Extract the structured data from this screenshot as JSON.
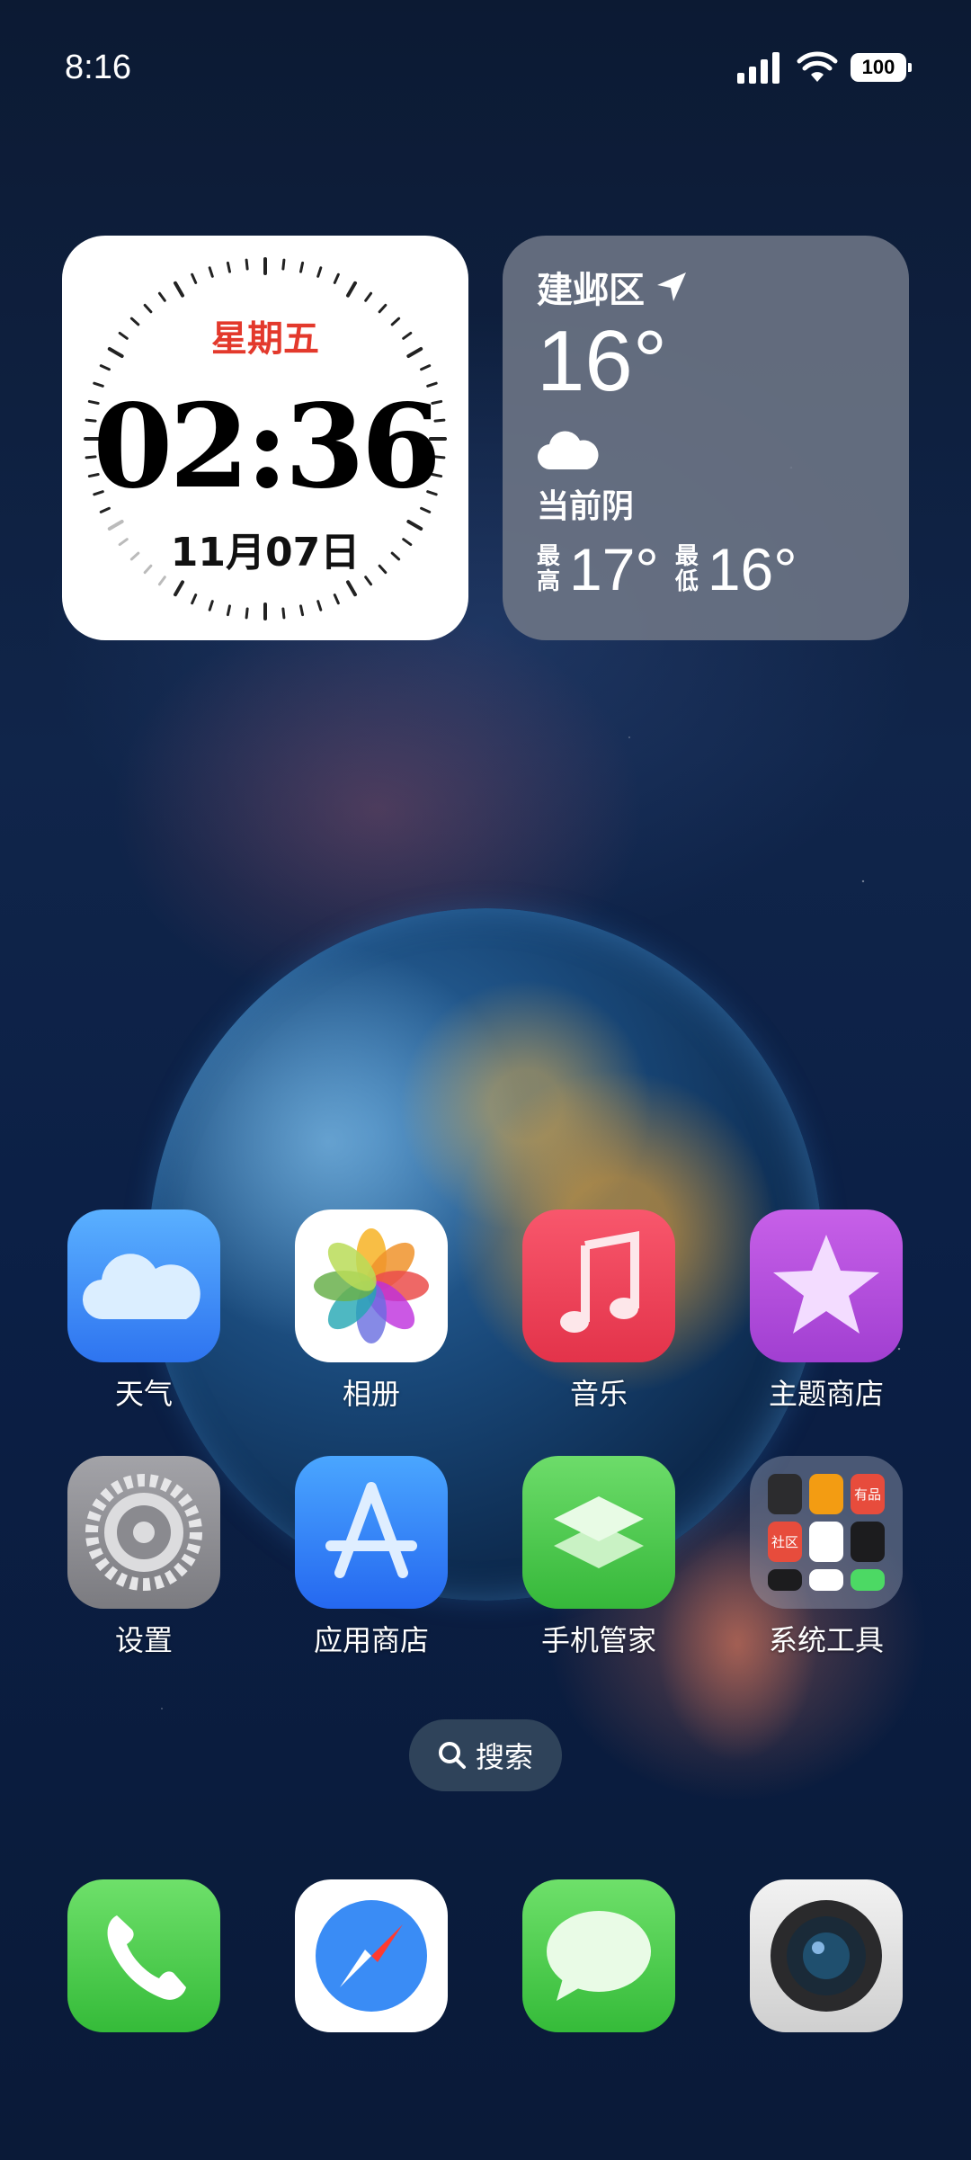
{
  "status_bar": {
    "time": "8:16",
    "battery": "100"
  },
  "clock_widget": {
    "weekday": "星期五",
    "time": "02:36",
    "date": "11月07日"
  },
  "weather_widget": {
    "location": "建邺区",
    "temperature": "16°",
    "condition": "当前阴",
    "high_label": "最高",
    "high_temp": "17°",
    "low_label": "最低",
    "low_temp": "16°"
  },
  "apps": [
    {
      "label": "天气",
      "icon": "weather-icon"
    },
    {
      "label": "相册",
      "icon": "photos-icon"
    },
    {
      "label": "音乐",
      "icon": "music-icon"
    },
    {
      "label": "主题商店",
      "icon": "theme-store-icon"
    },
    {
      "label": "设置",
      "icon": "settings-icon"
    },
    {
      "label": "应用商店",
      "icon": "app-store-icon"
    },
    {
      "label": "手机管家",
      "icon": "phone-manager-icon"
    },
    {
      "label": "系统工具",
      "icon": "system-tools-folder-icon"
    }
  ],
  "folder_mini_labels": {
    "community": "社区",
    "youpin": "有品"
  },
  "search": {
    "label": "搜索"
  },
  "dock": [
    {
      "icon": "phone-icon"
    },
    {
      "icon": "browser-compass-icon"
    },
    {
      "icon": "messages-icon"
    },
    {
      "icon": "camera-icon"
    }
  ],
  "colors": {
    "accent_red": "#e3392c",
    "weather_bg": "#6e7686"
  }
}
